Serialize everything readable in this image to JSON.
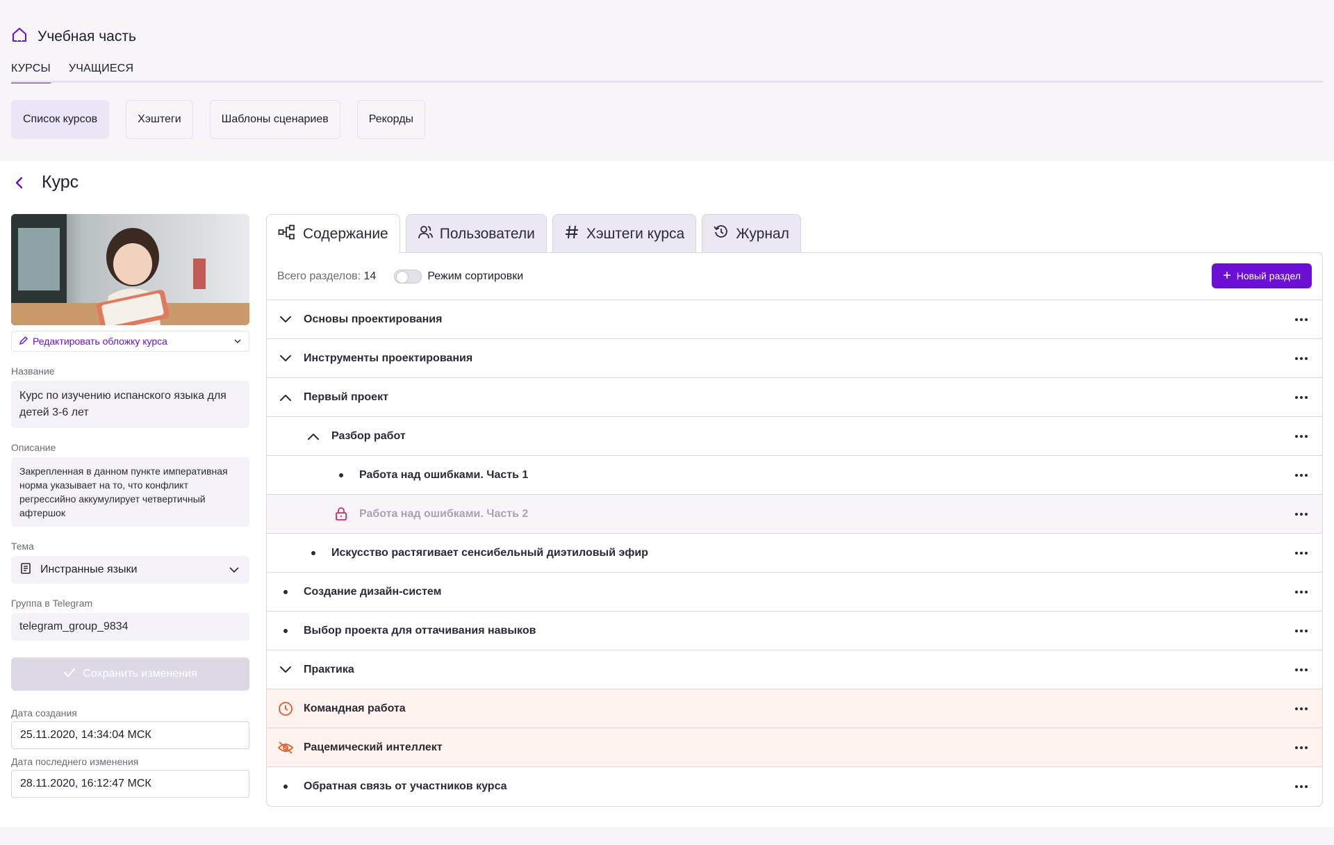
{
  "app": {
    "title": "Учебная часть"
  },
  "main_tabs": [
    {
      "label": "КУРСЫ",
      "active": true
    },
    {
      "label": "УЧАЩИЕСЯ",
      "active": false
    }
  ],
  "subnav": [
    {
      "label": "Список курсов",
      "active": true
    },
    {
      "label": "Хэштеги",
      "active": false
    },
    {
      "label": "Шаблоны сценариев",
      "active": false
    },
    {
      "label": "Рекорды",
      "active": false
    }
  ],
  "page": {
    "title": "Курс"
  },
  "left": {
    "edit_cover_label": "Редактировать обложку курса",
    "name_label": "Название",
    "name_value": "Курс по изучению испанского языка для детей 3-6 лет",
    "description_label": "Описание",
    "description_value": "Закрепленная в данном пункте императивная норма указывает на то, что конфликт регрессийно аккумулирует четвертичный афтершок",
    "topic_label": "Тема",
    "topic_value": "Инстранные языки",
    "telegram_label": "Группа в Telegram",
    "telegram_value": "telegram_group_9834",
    "save_label": "Сохранить изменения",
    "created_label": "Дата создания",
    "created_value": "25.11.2020, 14:34:04 МСК",
    "modified_label": "Дата последнего изменения",
    "modified_value": "28.11.2020, 16:12:47 МСК"
  },
  "content_tabs": [
    {
      "label": "Содержание",
      "icon": "structure-icon",
      "active": true
    },
    {
      "label": "Пользователи",
      "icon": "users-icon",
      "active": false
    },
    {
      "label": "Хэштеги курса",
      "icon": "hashtag-icon",
      "active": false
    },
    {
      "label": "Журнал",
      "icon": "history-icon",
      "active": false
    }
  ],
  "toolbar": {
    "count_label": "Всего разделов:",
    "count_value": "14",
    "sort_label": "Режим сортировки",
    "sort_enabled": false,
    "new_label": "Новый раздел"
  },
  "sections": [
    {
      "title": "Основы проектирования",
      "indent": 0,
      "icon": "chevron-down-icon",
      "state": "normal"
    },
    {
      "title": "Инструменты проектирования",
      "indent": 0,
      "icon": "chevron-down-icon",
      "state": "normal"
    },
    {
      "title": "Первый проект",
      "indent": 0,
      "icon": "chevron-up-icon",
      "state": "normal"
    },
    {
      "title": "Разбор работ",
      "indent": 1,
      "icon": "chevron-up-icon",
      "state": "normal"
    },
    {
      "title": "Работа над ошибками. Часть 1",
      "indent": 2,
      "icon": "bullet-icon",
      "state": "normal"
    },
    {
      "title": "Работа над ошибками. Часть 2",
      "indent": 2,
      "icon": "lock-icon",
      "state": "locked"
    },
    {
      "title": "Искусство растягивает сенсибельный диэтиловый эфир",
      "indent": 1,
      "icon": "bullet-icon",
      "state": "normal"
    },
    {
      "title": "Создание дизайн-систем",
      "indent": 0,
      "icon": "bullet-icon",
      "state": "normal"
    },
    {
      "title": "Выбор проекта для оттачивания навыков",
      "indent": 0,
      "icon": "bullet-icon",
      "state": "normal"
    },
    {
      "title": "Практика",
      "indent": 0,
      "icon": "chevron-down-icon",
      "state": "normal"
    },
    {
      "title": "Командная работа",
      "indent": 0,
      "icon": "clock-icon",
      "state": "scheduled"
    },
    {
      "title": "Рацемический интеллект",
      "indent": 0,
      "icon": "eye-off-icon",
      "state": "hidden"
    },
    {
      "title": "Обратная связь от участников курса",
      "indent": 0,
      "icon": "bullet-icon",
      "state": "normal"
    }
  ],
  "colors": {
    "accent": "#6b0fd6",
    "warning_bg": "#fff3ef",
    "warning_icon": "#e8572a",
    "lock_icon": "#e0245e"
  }
}
